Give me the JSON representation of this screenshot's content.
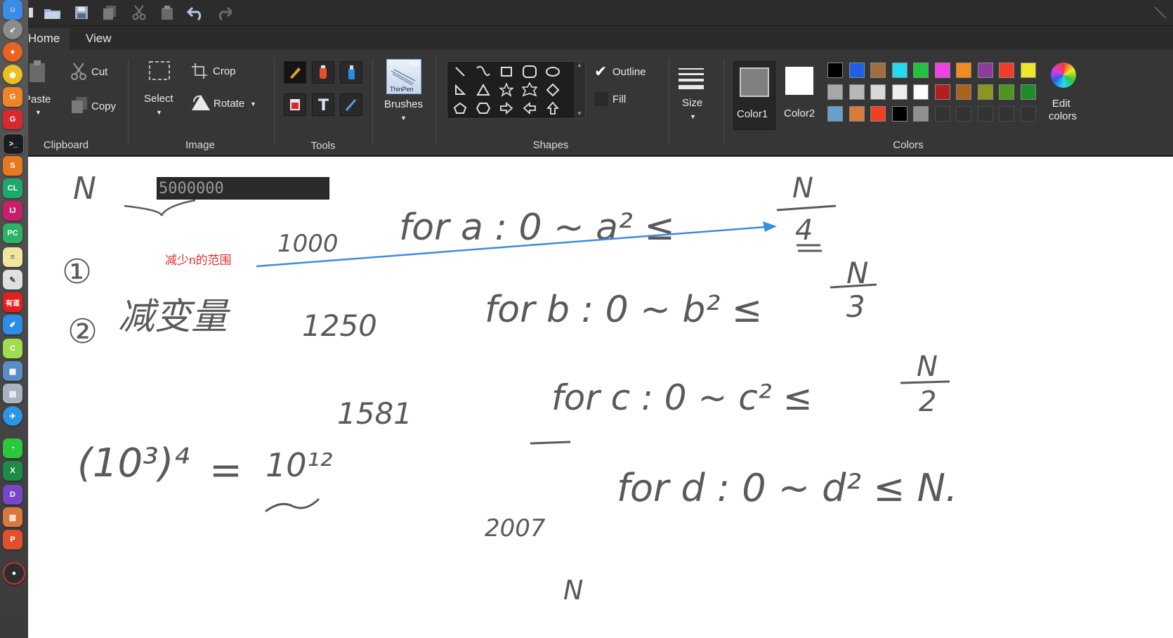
{
  "window": {
    "tabs": [
      {
        "label": "Home"
      },
      {
        "label": "View"
      }
    ]
  },
  "ribbon": {
    "clipboard": {
      "group_label": "Clipboard",
      "paste_label": "Paste",
      "cut_label": "Cut",
      "copy_label": "Copy"
    },
    "image": {
      "group_label": "Image",
      "select_label": "Select",
      "crop_label": "Crop",
      "rotate_label": "Rotate"
    },
    "tools": {
      "group_label": "Tools"
    },
    "brushes": {
      "label": "Brushes",
      "thumb_text_1": "Ink",
      "thumb_text_2": "ThinPen"
    },
    "shapes": {
      "group_label": "Shapes",
      "outline_label": "Outline",
      "fill_label": "Fill"
    },
    "size": {
      "label": "Size"
    },
    "colors": {
      "group_label": "Colors",
      "color1_label": "Color1",
      "color2_label": "Color2",
      "edit_label_1": "Edit",
      "edit_label_2": "colors",
      "color1_value": "#808080",
      "color2_value": "#ffffff",
      "palette": [
        [
          "#000000",
          "#1e5fe6",
          "#a0703c",
          "#24d8f0",
          "#22c23c",
          "#f040e6",
          "#f08c1e",
          "#8c3c9c",
          "#f03c28",
          "#f0e628"
        ],
        [
          "#a8a8a8",
          "#b8b8b8",
          "#d8d8d8",
          "#eeeeee",
          "#ffffff",
          "#b41e1e",
          "#a8641e",
          "#8c961e",
          "#4c961e",
          "#1e8c28"
        ],
        [
          "#64a0d0",
          "#d87c3c",
          "#f04020",
          "#000000",
          "#909090",
          null,
          null,
          null,
          null,
          null
        ]
      ]
    }
  },
  "canvas": {
    "n_input_value": "5000000",
    "annotation_text": "减少n的范围",
    "handwriting": {
      "n_label": "N",
      "step1": "①",
      "step2": "②",
      "reduce_vars": "减变量",
      "n1000": "1000",
      "n1250": "1250",
      "n1581": "1581",
      "n2007": "2007",
      "loop_a": "for  a : 0 ~  a² ≤",
      "loop_b": "for  b : 0 ~  b² ≤",
      "loop_c": "for  c : 0 ~  c² ≤",
      "loop_d": "for  d : 0 ~  d² ≤ N.",
      "frac_a_num": "N",
      "frac_a_den": "4",
      "frac_b_num": "N",
      "frac_b_den": "3",
      "frac_c_num": "N",
      "frac_c_den": "2",
      "power_expr": "(10³)⁴",
      "equals": "=",
      "ten12": "10¹²",
      "bottom_n": "N"
    }
  }
}
